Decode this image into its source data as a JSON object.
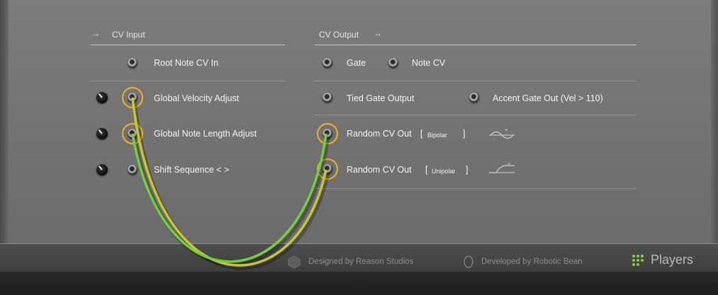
{
  "cv_input": {
    "header": "CV Input",
    "root_note": "Root Note CV In",
    "global_velocity": "Global Velocity Adjust",
    "global_note_length": "Global Note Length Adjust",
    "shift_sequence": "Shift Sequence < >"
  },
  "cv_output": {
    "header": "CV Output",
    "gate": "Gate",
    "note_cv": "Note CV",
    "tied_gate": "Tied Gate Output",
    "accent_gate": "Accent Gate Out (Vel > 110)",
    "random_bipolar": "Random CV Out",
    "bipolar_tag": "Bipolar",
    "random_unipolar": "Random CV Out",
    "unipolar_tag": "Unipolar"
  },
  "footer": {
    "designed_by": "Designed by Reason Studios",
    "developed_by": "Developed by Robotic Bean",
    "brand": "Players",
    "brand_mark": "·"
  },
  "icons": {
    "arrow": "arrow-right-icon",
    "jack": "cv-jack-icon",
    "knob": "trim-knob-icon",
    "bipolar_wave": "bipolar-wave-icon",
    "unipolar_wave": "unipolar-wave-icon"
  },
  "colors": {
    "highlight_ring": "#f2b21a",
    "cable_yellow": "#c9c825",
    "cable_green": "#6fd23a"
  }
}
